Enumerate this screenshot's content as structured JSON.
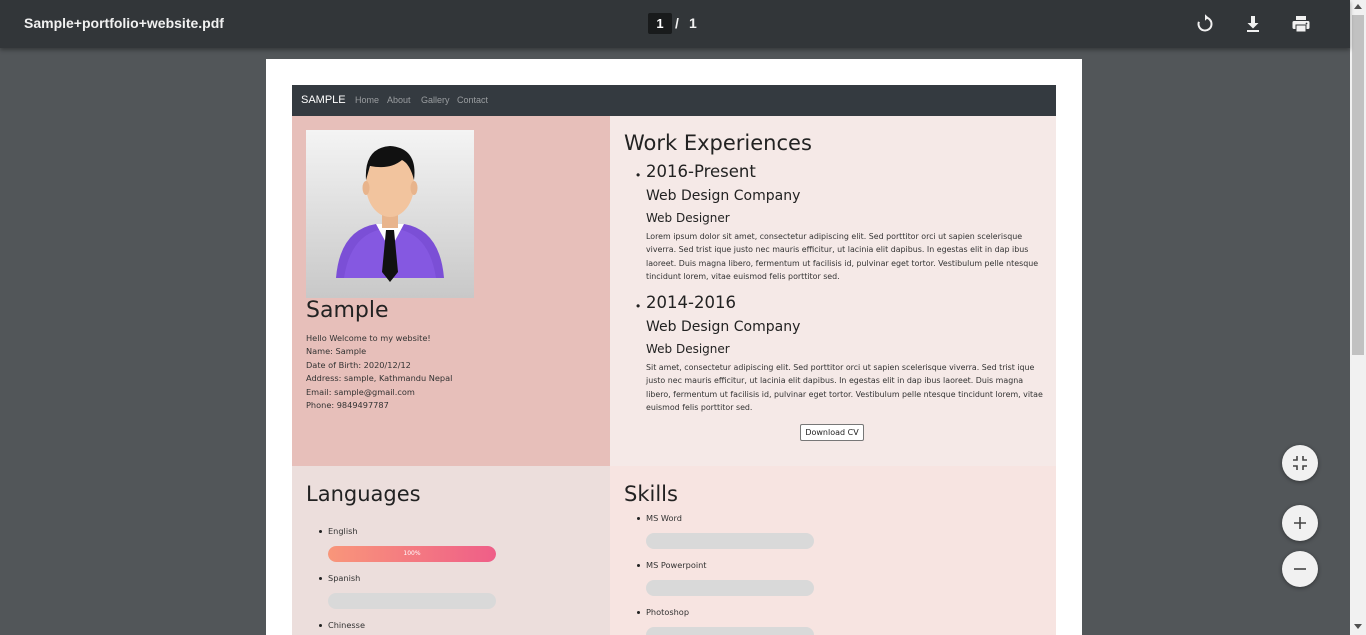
{
  "viewer": {
    "title": "Sample+portfolio+website.pdf",
    "current_page": "1",
    "separator": "/",
    "total_pages": "1",
    "icons": {
      "rotate": "rotate-icon",
      "download": "download-icon",
      "print": "print-icon"
    },
    "controls": {
      "fit": "fit-page-icon",
      "zoom_in": "zoom-in-icon",
      "zoom_out": "zoom-out-icon"
    }
  },
  "site": {
    "brand": "SAMPLE",
    "nav": [
      "Home",
      "About",
      "Gallery",
      "Contact"
    ],
    "profile": {
      "name": "Sample",
      "info": [
        "Hello Welcome to my website!",
        "Name: Sample",
        "Date of Birth: 2020/12/12",
        "Address: sample, Kathmandu Nepal",
        "Email: sample@gmail.com",
        "Phone: 9849497787"
      ]
    },
    "work": {
      "heading": "Work Experiences",
      "items": [
        {
          "years": "2016-Present",
          "company": "Web Design Company",
          "role": "Web Designer",
          "lines": [
            "Lorem ipsum dolor sit amet, consectetur adipiscing elit. Sed porttitor orci ut sapien scelerisque",
            "viverra. Sed trist ique justo nec mauris efficitur, ut lacinia elit dapibus. In egestas elit in dap ibus",
            "laoreet. Duis magna libero, fermentum ut facilisis id, pulvinar eget tortor. Vestibulum pelle ntesque",
            "tincidunt lorem, vitae euismod felis porttitor sed."
          ]
        },
        {
          "years": "2014-2016",
          "company": "Web Design Company",
          "role": "Web Designer",
          "lines": [
            "Sit amet, consectetur adipiscing elit. Sed porttitor orci ut sapien scelerisque viverra. Sed trist ique",
            "justo nec mauris efficitur, ut lacinia elit dapibus. In egestas elit in dap ibus laoreet. Duis magna",
            "libero, fermentum ut facilisis id, pulvinar eget tortor. Vestibulum pelle ntesque tincidunt lorem, vitae",
            "euismod felis porttitor sed."
          ]
        }
      ],
      "download_button": "Download CV"
    },
    "languages": {
      "heading": "Languages",
      "items": [
        {
          "name": "English",
          "progress": 1.0,
          "label": "100%"
        },
        {
          "name": "Spanish",
          "progress": 0,
          "label": ""
        },
        {
          "name": "Chinesse",
          "progress": 0,
          "label": ""
        }
      ]
    },
    "skills": {
      "heading": "Skills",
      "items": [
        {
          "name": "MS Word",
          "progress": 0
        },
        {
          "name": "MS Powerpoint",
          "progress": 0
        },
        {
          "name": "Photoshop",
          "progress": 0
        }
      ]
    }
  },
  "colors": {
    "toolbar": "#323639",
    "viewer_bg": "#525659",
    "site_nav": "#343a40",
    "hero_left": "#e7bfba",
    "hero_right": "#f5e9e7",
    "lang_panel": "#ecdedc",
    "skills_panel": "#f7e4e1",
    "progress_start": "#f9967a",
    "progress_end": "#ef5e88"
  }
}
